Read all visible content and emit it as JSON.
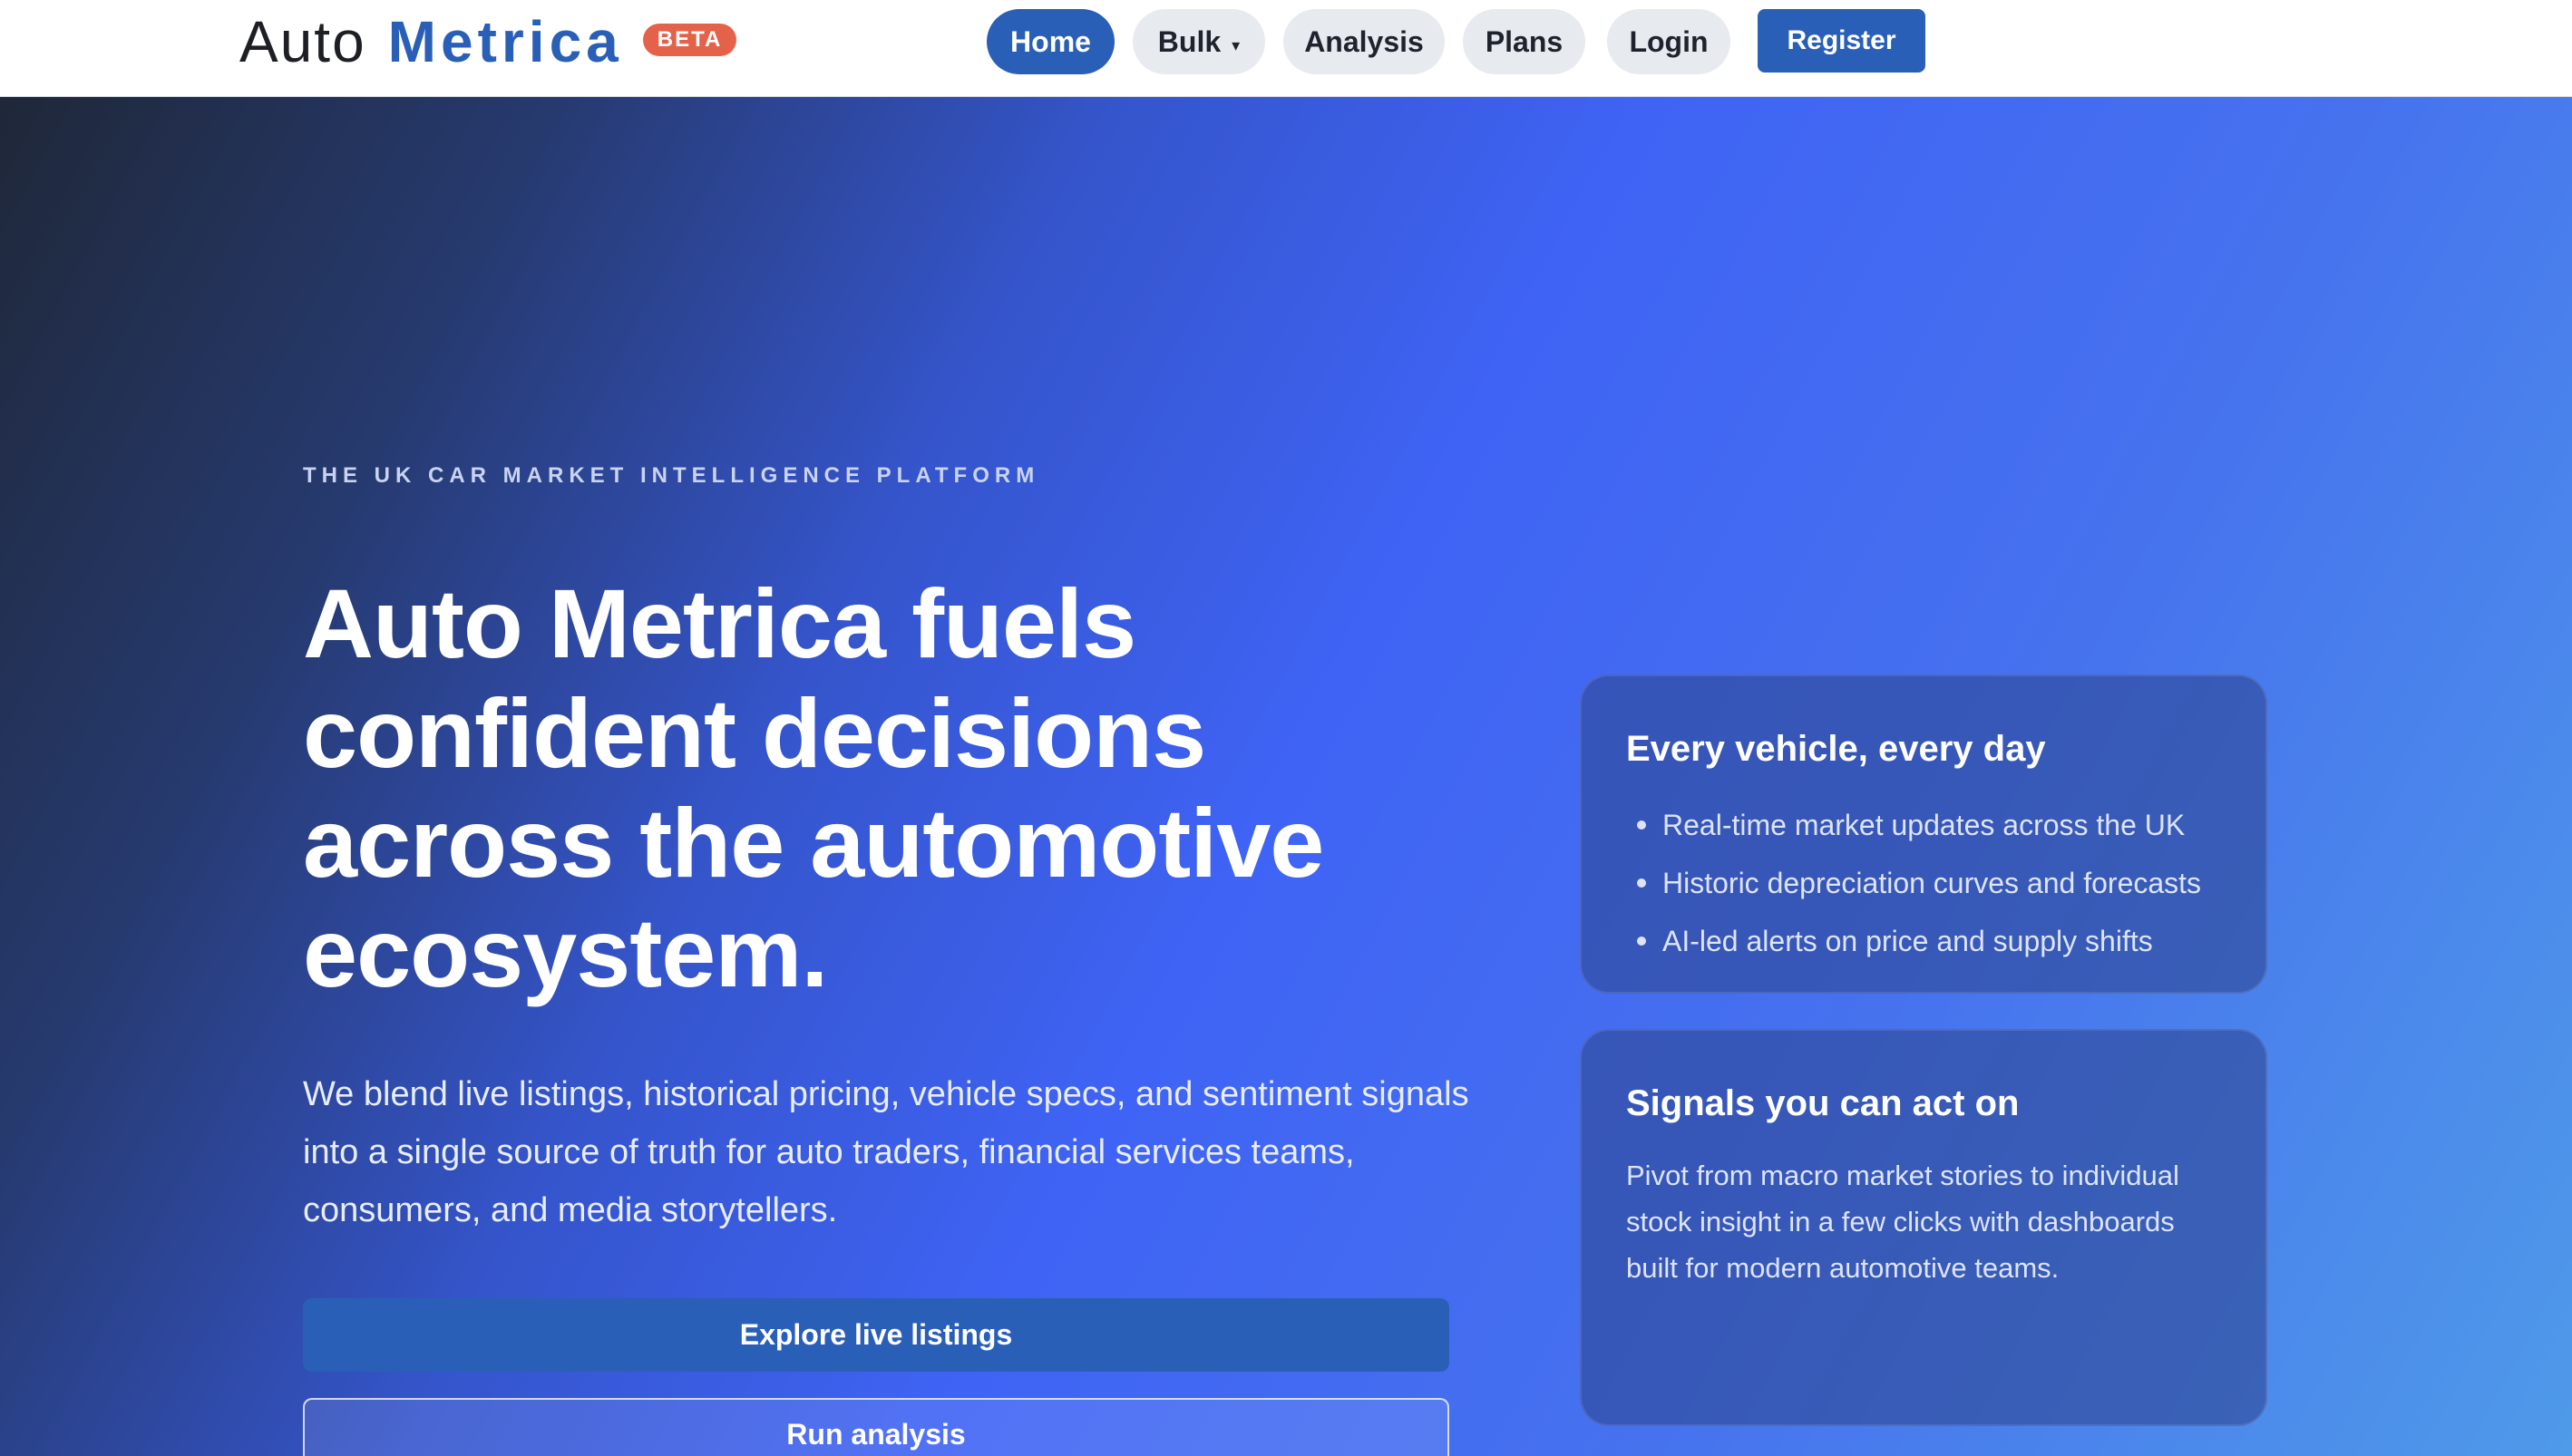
{
  "brand": {
    "name_part1": "Auto",
    "name_part2": "Metrica",
    "badge": "BETA"
  },
  "nav": {
    "items": [
      {
        "label": "Home",
        "active": true
      },
      {
        "label": "Bulk",
        "has_dropdown": true,
        "caret": "▾"
      },
      {
        "label": "Analysis"
      },
      {
        "label": "Plans"
      },
      {
        "label": "Login"
      }
    ],
    "register": "Register"
  },
  "hero": {
    "eyebrow": "THE UK CAR MARKET INTELLIGENCE PLATFORM",
    "headline": "Auto Metrica fuels confident decisions across the automotive ecosystem.",
    "lead": "We blend live listings, historical pricing, vehicle specs, and sentiment signals into a single source of truth for auto traders, financial services teams, consumers, and media storytellers.",
    "primary_button": "Explore live listings",
    "secondary_button": "Run analysis"
  },
  "cards": [
    {
      "title": "Every vehicle, every day",
      "bullets": [
        "Real-time market updates across the UK",
        "Historic depreciation curves and forecasts",
        "AI-led alerts on price and supply shifts"
      ]
    },
    {
      "title": "Signals you can act on",
      "body": "Pivot from macro market stories to individual stock insight in a few clicks with dashboards built for modern automotive teams."
    }
  ],
  "colors": {
    "brand_blue": "#2a5fb8",
    "beta_badge": "#e4624a",
    "nav_pill": "#e7eaef",
    "hero_gradient_start": "#1f2738",
    "hero_gradient_mid": "#3f63f5",
    "hero_gradient_end": "#4f9ae9"
  }
}
